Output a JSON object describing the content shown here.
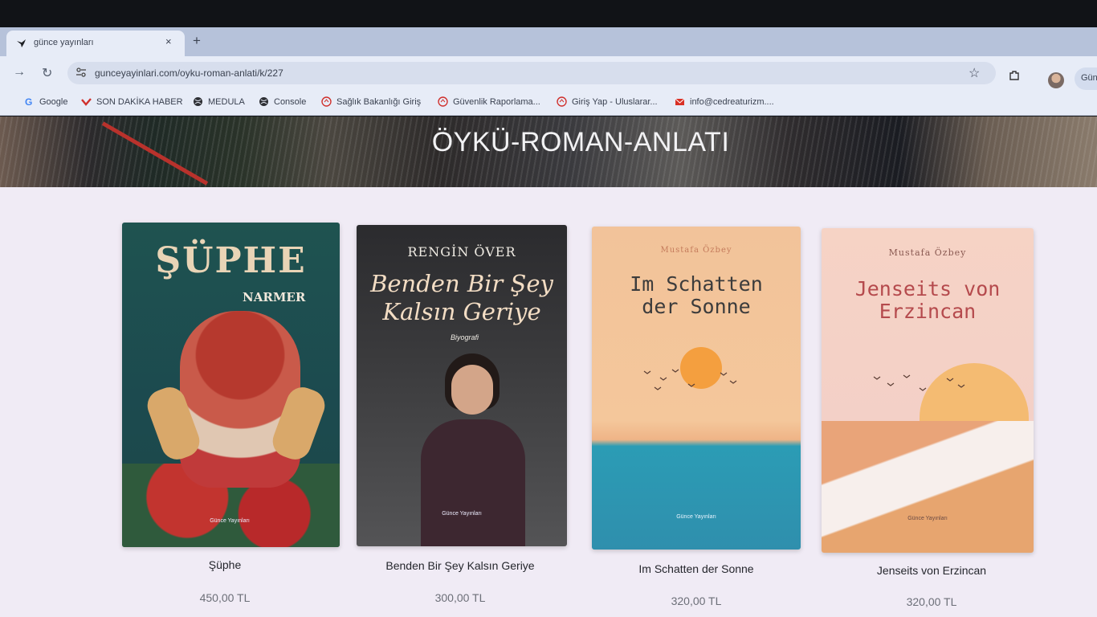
{
  "browser": {
    "tab_title": "günce yayınları",
    "tab_close": "×",
    "new_tab": "+",
    "url": "gunceyayinlari.com/oyku-roman-anlati/k/227",
    "profile_label": "Gün"
  },
  "bookmarks": [
    {
      "label": "Google",
      "icon": "google-icon"
    },
    {
      "label": "SON DAKİKA HABER",
      "icon": "news-icon"
    },
    {
      "label": "MEDULA",
      "icon": "globe-icon"
    },
    {
      "label": "Console",
      "icon": "globe-icon"
    },
    {
      "label": "Sağlık Bakanlığı Giriş",
      "icon": "ministry-icon"
    },
    {
      "label": "Güvenlik Raporlama...",
      "icon": "ministry-icon"
    },
    {
      "label": "Giriş Yap - Uluslarar...",
      "icon": "ministry-icon"
    },
    {
      "label": "info@cedreaturizm....",
      "icon": "mail-icon"
    }
  ],
  "page": {
    "category_title": "ÖYKÜ-ROMAN-ANLATI"
  },
  "products": [
    {
      "name": "Şüphe",
      "price": "450,00 TL",
      "cover": {
        "title": "ŞÜPHE",
        "author": "NARMER",
        "publisher": "Günce Yayınları"
      }
    },
    {
      "name": "Benden Bir Şey Kalsın Geriye",
      "price": "300,00 TL",
      "cover": {
        "author": "RENGİN ÖVER",
        "title_line1": "Benden Bir Şey",
        "title_line2": "Kalsın Geriye",
        "genre": "Biyografi",
        "publisher": "Günce Yayınları"
      }
    },
    {
      "name": "Im Schatten der Sonne",
      "price": "320,00 TL",
      "cover": {
        "author": "Mustafa Özbey",
        "title_line1": "Im Schatten",
        "title_line2": "der Sonne",
        "publisher": "Günce Yayınları"
      }
    },
    {
      "name": "Jenseits von Erzincan",
      "price": "320,00 TL",
      "cover": {
        "author": "Mustafa Özbey",
        "title_line1": "Jenseits von",
        "title_line2": "Erzincan",
        "publisher": "Günce Yayınları"
      }
    }
  ],
  "colors": {
    "hero_title": "#f2f2f4",
    "page_bg": "#f0ebf5"
  }
}
